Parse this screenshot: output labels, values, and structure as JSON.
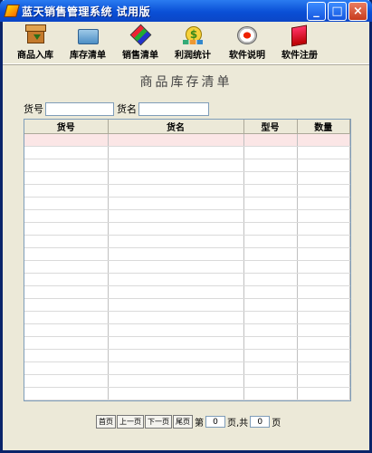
{
  "window": {
    "title": "蓝天销售管理系统 试用版"
  },
  "toolbar": [
    {
      "label": "商品入库",
      "icon": "box-icon"
    },
    {
      "label": "库存清单",
      "icon": "folder-icon"
    },
    {
      "label": "销售清单",
      "icon": "cube-icon"
    },
    {
      "label": "利润统计",
      "icon": "coin-icon"
    },
    {
      "label": "软件说明",
      "icon": "disc-icon"
    },
    {
      "label": "软件注册",
      "icon": "book-icon"
    }
  ],
  "heading": "商品库存清单",
  "search": {
    "code_label": "货号",
    "code_value": "",
    "name_label": "货名",
    "name_value": ""
  },
  "table": {
    "columns": [
      "货号",
      "货名",
      "型号",
      "数量"
    ],
    "rows": []
  },
  "pager": {
    "first": "首页",
    "prev": "上一页",
    "next": "下一页",
    "last": "尾页",
    "page_prefix": "第",
    "current": "0",
    "page_mid": "页,共",
    "total": "0",
    "page_suffix": "页"
  },
  "colors": {
    "titlebar": "#0a4fd6",
    "selected_row": "#fbe6e6",
    "background": "#ece9d8"
  }
}
